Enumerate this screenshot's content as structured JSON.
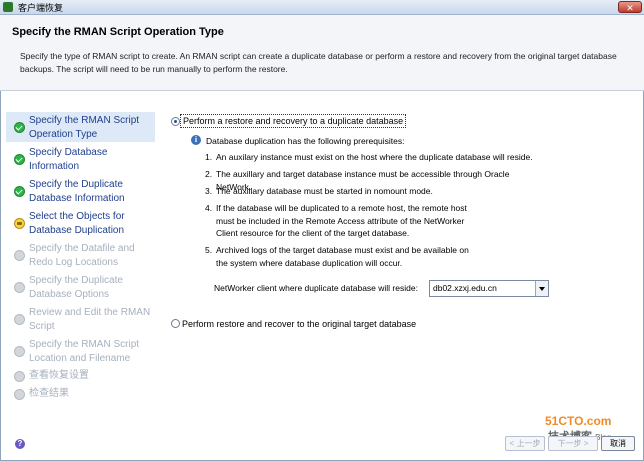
{
  "window": {
    "title": "客户端恢复",
    "close_label": "✕"
  },
  "header": {
    "title": "Specify the RMAN Script Operation Type",
    "description": "Specify the type of RMAN script to create. An RMAN script can create a duplicate database or perform a restore and recovery from the original target database backups.  The script will need to be run manually to perform the restore."
  },
  "sidebar": {
    "steps": [
      {
        "label": "Specify the RMAN Script Operation Type",
        "status": "done"
      },
      {
        "label": "Specify Database Information",
        "status": "done"
      },
      {
        "label": "Specify the Duplicate Database Information",
        "status": "done"
      },
      {
        "label": "Select the Objects for Database Duplication",
        "status": "current"
      },
      {
        "label": "Specify the Datafile and Redo Log Locations",
        "status": "pending"
      },
      {
        "label": "Specify the Duplicate Database Options",
        "status": "pending"
      },
      {
        "label": "Review and Edit the RMAN Script",
        "status": "pending"
      },
      {
        "label": "Specify the RMAN Script Location and Filename",
        "status": "pending"
      },
      {
        "label": "查看恢复设置",
        "status": "pending"
      },
      {
        "label": "检查结果",
        "status": "pending"
      }
    ]
  },
  "main": {
    "option_duplicate": "Perform a restore and recovery to a duplicate database",
    "intro": "Database duplication has the following prerequisites:",
    "prereqs": [
      {
        "num": "1.",
        "text": "An auxilary instance must exist on the host where the duplicate database will reside."
      },
      {
        "num": "2.",
        "text": "The auxillary and target database instance must be accessible through Oracle NetWork."
      },
      {
        "num": "3.",
        "text": "The auxillary database must be started in nomount mode."
      },
      {
        "num": "4.",
        "text": "If the database will be duplicated to a remote host, the remote host must be included in the Remote Access attribute of the NetWorker Client resource for the client of the target database."
      },
      {
        "num": "5.",
        "text": "Archived logs of the target database must exist and be available on the system where database duplication will occur."
      }
    ],
    "networker_label": "NetWorker client where duplicate database will reside:",
    "networker_value": "db02.xzxj.edu.cn",
    "option_original": "Perform restore and recover to the original target database"
  },
  "footer": {
    "help_label": "?",
    "back_label": "< 上一步",
    "next_label": "下一步 >",
    "cancel_label": "取消"
  },
  "watermark": {
    "site": "51CTO.com",
    "blog": "技术博客",
    "suffix": "Blog"
  },
  "colors": {
    "accent": "#1e4fa8",
    "done": "#2db34a",
    "current": "#f7d34a",
    "pending": "#d3d6da"
  }
}
